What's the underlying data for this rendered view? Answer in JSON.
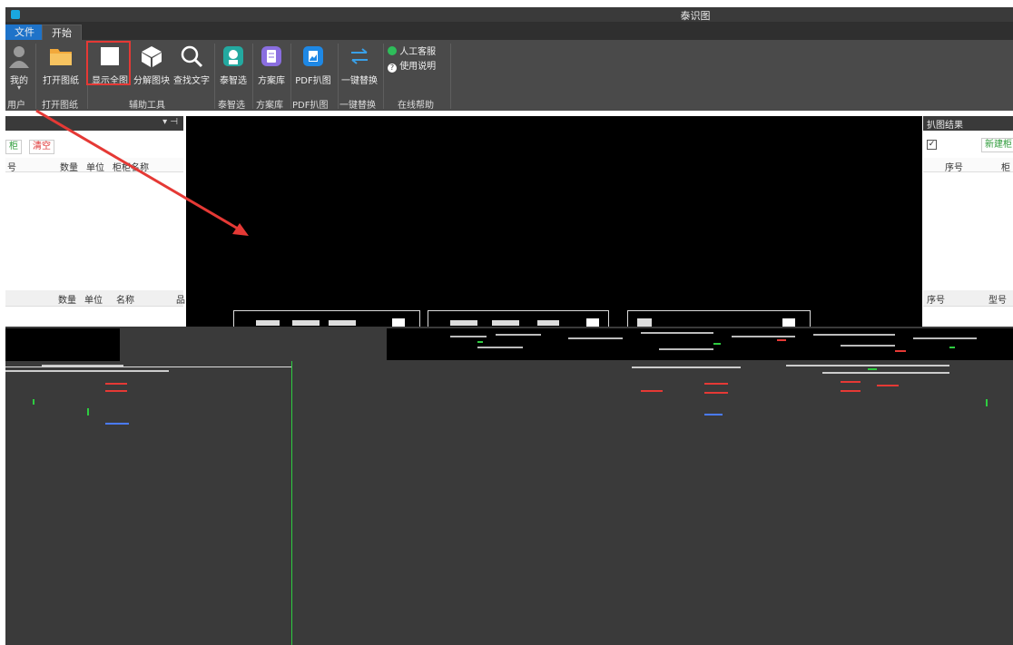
{
  "title_bar": {
    "app_title": "泰识图"
  },
  "tabs": [
    {
      "label": "文件"
    },
    {
      "label": "开始"
    }
  ],
  "ribbon": {
    "buttons": [
      {
        "label": "我的",
        "icon": "user-icon"
      },
      {
        "label": "打开图纸",
        "icon": "folder-icon"
      },
      {
        "label": "显示全图",
        "icon": "fullscreen-icon"
      },
      {
        "label": "分解图块",
        "icon": "cube-icon"
      },
      {
        "label": "查找文字",
        "icon": "search-icon"
      },
      {
        "label": "泰智选",
        "icon": "robot-icon"
      },
      {
        "label": "方案库",
        "icon": "scheme-library-icon"
      },
      {
        "label": "PDF扒图",
        "icon": "pdf-icon"
      },
      {
        "label": "一键替换",
        "icon": "swap-icon"
      }
    ],
    "help_items": [
      {
        "label": "人工客服",
        "icon": "chat-icon"
      },
      {
        "label": "使用说明",
        "icon": "help-icon"
      }
    ],
    "groups": [
      "用户",
      "打开图纸",
      "辅助工具",
      "泰智选",
      "方案库",
      "PDF扒图",
      "一键替换",
      "在线帮助"
    ]
  },
  "left_panel": {
    "header_ctrl": "▾ ⊣",
    "btn_cabinet": "柜",
    "btn_clear": "清空",
    "table1_cols": [
      "号",
      "数量",
      "单位",
      "柜柜名称"
    ],
    "table2_cols": [
      "数量",
      "单位",
      "名称",
      "品"
    ]
  },
  "right_panel": {
    "title": "扒图结果",
    "check_mark": "✓",
    "new_button": "新建柜",
    "table1_cols": [
      "序号",
      "柜"
    ],
    "table2_cols": [
      "序号",
      "型号"
    ]
  },
  "colors": {
    "highlight": "#e53935",
    "ribbon_bg": "#4a4a4a",
    "file_tab": "#1e73c9",
    "arrow": "#e53935"
  }
}
